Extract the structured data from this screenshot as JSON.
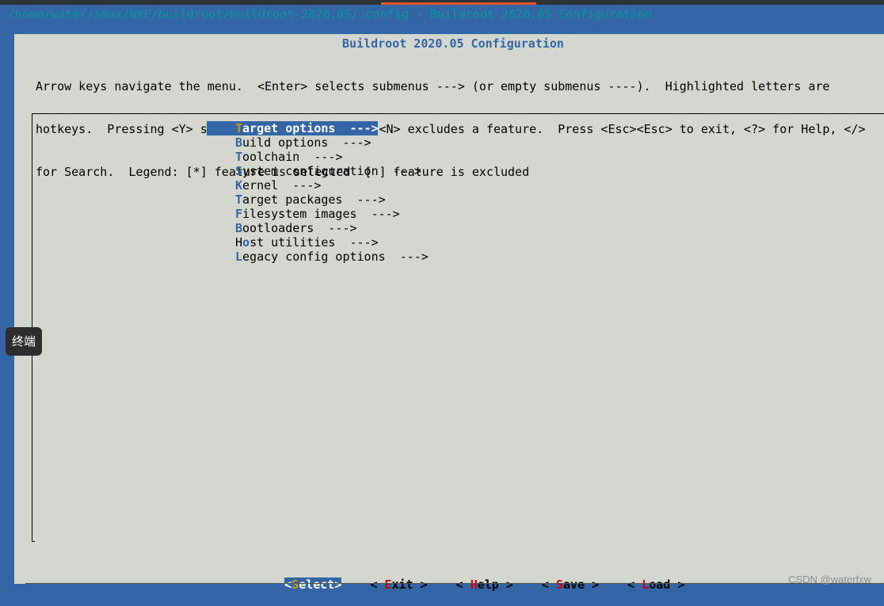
{
  "window": {
    "title": "/home/water/imax/NXP/buildroot/buildroot-2020.05/.config - Buildroot 2020.05 Configuration"
  },
  "panel": {
    "title": "Buildroot 2020.05 Configuration",
    "help_lines": [
      "Arrow keys navigate the menu.  <Enter> selects submenus ---> (or empty submenus ----).  Highlighted letters are",
      "hotkeys.  Pressing <Y> selects a feature, while <N> excludes a feature.  Press <Esc><Esc> to exit, <?> for Help, </>",
      "for Search.  Legend: [*] feature is selected  [ ] feature is excluded"
    ]
  },
  "menu": {
    "items": [
      {
        "hotkey": "T",
        "rest": "arget options  --->"
      },
      {
        "hotkey": "B",
        "rest": "uild options  --->"
      },
      {
        "hotkey": "T",
        "rest": "oolchain  --->"
      },
      {
        "hotkey": "S",
        "rest": "ystem configuration  --->"
      },
      {
        "hotkey": "K",
        "rest": "ernel  --->"
      },
      {
        "hotkey": "T",
        "rest": "arget packages  --->"
      },
      {
        "hotkey": "F",
        "rest": "ilesystem images  --->"
      },
      {
        "hotkey": "B",
        "rest": "ootloaders  --->"
      },
      {
        "prefix": "H",
        "hotkey": "o",
        "rest": "st utilities  --->"
      },
      {
        "hotkey": "L",
        "rest": "egacy config options  --->"
      }
    ]
  },
  "buttons": {
    "select": {
      "left": "<",
      "hotkey": "S",
      "right": "elect>"
    },
    "exit": {
      "left": "< ",
      "hotkey": "E",
      "right": "xit >"
    },
    "help": {
      "left": "< ",
      "hotkey": "H",
      "right": "elp >"
    },
    "save": {
      "left": "< ",
      "hotkey": "S",
      "right": "ave >"
    },
    "load": {
      "left": "< ",
      "hotkey": "L",
      "right": "oad >"
    }
  },
  "tooltip": {
    "text": "终端"
  },
  "watermark": {
    "text": "CSDN @waterfxw"
  },
  "colors": {
    "accent": "#3465a4",
    "panel_bg": "#d3d7cf",
    "hotkey_selected": "#c4a000",
    "button_hotkey": "#cc0000"
  }
}
